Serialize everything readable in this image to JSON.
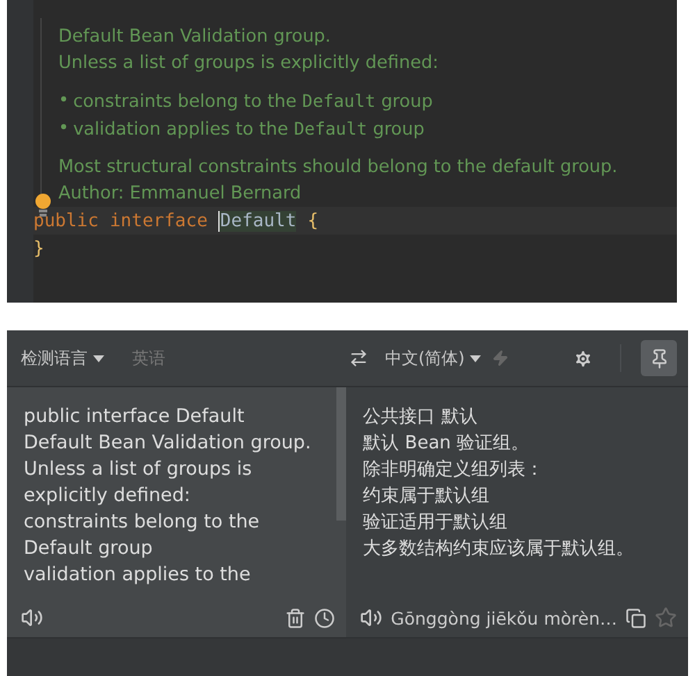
{
  "editor": {
    "doc": {
      "summary": "Default Bean Validation group.",
      "lead": "Unless a list of groups is explicitly defined:",
      "bullets": [
        {
          "marker": "•",
          "before": "constraints belong to the",
          "code": "Default",
          "after": "group"
        },
        {
          "marker": "•",
          "before": "validation applies to the",
          "code": "Default",
          "after": "group"
        }
      ],
      "note": "Most structural constraints should belong to the default group.",
      "author": "Author: Emmanuel Bernard"
    },
    "code_lines": [
      {
        "tokens": [
          {
            "kind": "keyword",
            "text": "public"
          },
          {
            "kind": "keyword",
            "text": "interface"
          },
          {
            "kind": "identifier",
            "text": "Default",
            "caret": true
          },
          {
            "kind": "brace",
            "text": "{"
          }
        ]
      },
      {
        "tokens": [
          {
            "kind": "brace",
            "text": "}"
          }
        ]
      }
    ]
  },
  "translator": {
    "source_language": "检测语言",
    "detected_language": "英语",
    "target_language": "中文(简体)",
    "pinned": true,
    "source_lines": [
      "public interface Default",
      "Default Bean Validation group.",
      "Unless a list of groups is",
      "explicitly defined:",
      "constraints belong to the",
      "Default group",
      "validation applies to the"
    ],
    "target_lines": [
      "公共接口 默认",
      "默认 Bean 验证组。",
      "除非明确定义组列表：",
      "约束属于默认组",
      "验证适用于默认组",
      "大多数结构约束应该属于默认组。"
    ],
    "romanization": "Gōnggòng jiēkǒu mòrèn…",
    "starred": false
  }
}
